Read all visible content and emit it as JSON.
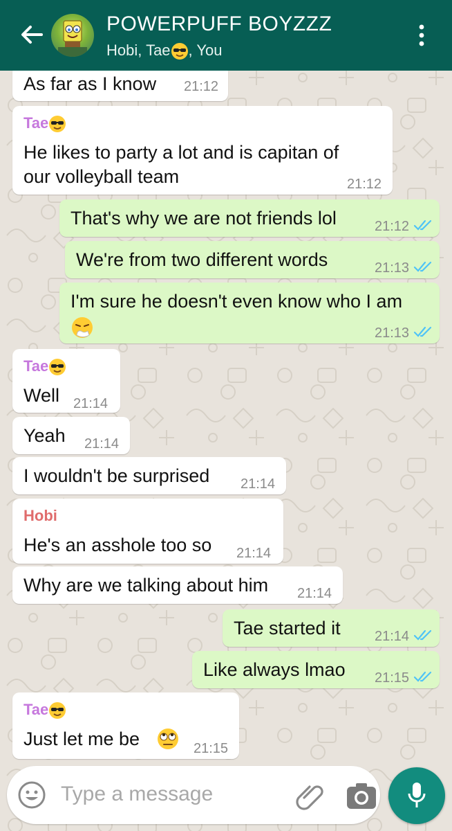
{
  "header": {
    "title": "POWERPUFF BOYZZZ",
    "subtitle_before": "Hobi, Tae",
    "subtitle_after": ", You"
  },
  "messages": [
    {
      "dir": "in",
      "sender": "",
      "lines": [
        "As far as I know"
      ],
      "time": "21:12"
    },
    {
      "dir": "in",
      "sender": "Tae",
      "lines": [
        "He likes to party a lot and is capitan of",
        "our volleyball team"
      ],
      "time": "21:12"
    },
    {
      "dir": "out",
      "lines": [
        "That's why we are not friends lol"
      ],
      "time": "21:12"
    },
    {
      "dir": "out",
      "lines": [
        "We're from two different words"
      ],
      "time": "21:13"
    },
    {
      "dir": "out",
      "lines": [
        "I'm sure he doesn't even know who I am"
      ],
      "time": "21:13"
    },
    {
      "dir": "in",
      "sender": "Tae",
      "lines": [
        "Well"
      ],
      "time": "21:14"
    },
    {
      "dir": "in",
      "sender": "",
      "lines": [
        "Yeah"
      ],
      "time": "21:14"
    },
    {
      "dir": "in",
      "sender": "",
      "lines": [
        "I wouldn't be surprised"
      ],
      "time": "21:14"
    },
    {
      "dir": "in",
      "sender": "Hobi",
      "lines": [
        "He's an asshole too so"
      ],
      "time": "21:14"
    },
    {
      "dir": "in",
      "sender": "",
      "lines": [
        "Why are we talking about him"
      ],
      "time": "21:14"
    },
    {
      "dir": "out",
      "lines": [
        "Tae started it"
      ],
      "time": "21:14"
    },
    {
      "dir": "out",
      "lines": [
        "Like always lmao"
      ],
      "time": "21:15"
    },
    {
      "dir": "in",
      "sender": "Tae",
      "lines": [
        "Just let me be"
      ],
      "time": "21:15"
    }
  ],
  "composer": {
    "placeholder": "Type a message"
  },
  "colors": {
    "header": "#075e54",
    "outgoing": "#dcf8c6",
    "incoming": "#ffffff",
    "tae_name": "#c678dd",
    "hobi_name": "#e06c6c",
    "read_ticks": "#4fc3f7",
    "mic_button": "#128c7e"
  },
  "icons": {
    "back": "arrow-left-icon",
    "menu": "kebab-menu-icon",
    "emoji": "smiley-icon",
    "attach": "paperclip-icon",
    "camera": "camera-icon",
    "mic": "microphone-icon",
    "tae_emoji": "sunglasses-face-emoji",
    "sneeze_emoji": "sneezing-face-emoji",
    "eyeroll_emoji": "eye-roll-face-emoji"
  }
}
